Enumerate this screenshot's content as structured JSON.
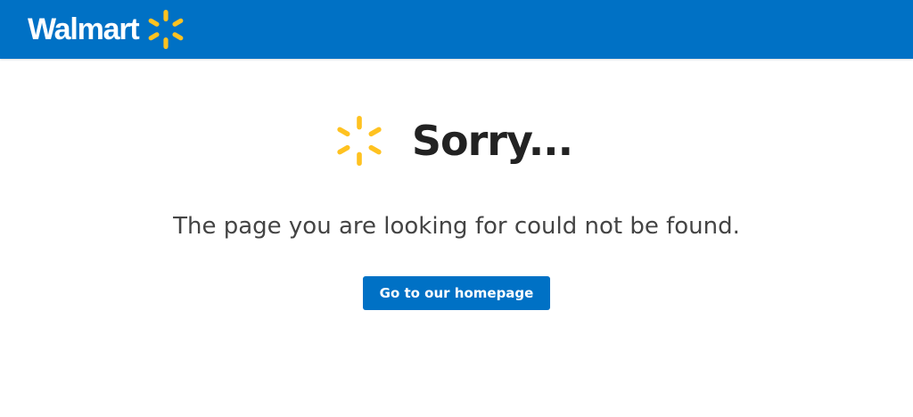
{
  "header": {
    "logo_text": "Walmart",
    "logo_icon": "spark-icon",
    "background_color": "#0071c5"
  },
  "main": {
    "title": "Sorry...",
    "title_icon": "spark-icon",
    "message": "The page you are looking for could not be found.",
    "home_button_label": "Go to our homepage"
  },
  "colors": {
    "brand_blue": "#0071c5",
    "spark_yellow": "#ffc220",
    "title_text": "#222222",
    "message_text": "#444444"
  }
}
